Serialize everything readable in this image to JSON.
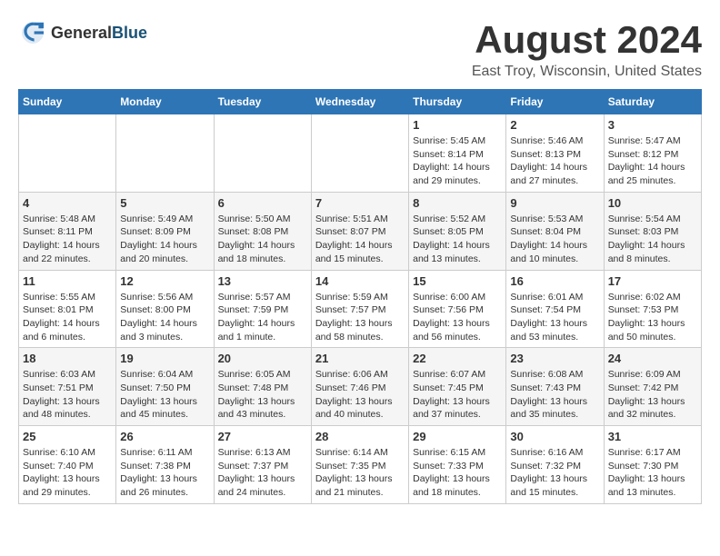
{
  "header": {
    "logo_general": "General",
    "logo_blue": "Blue",
    "title": "August 2024",
    "subtitle": "East Troy, Wisconsin, United States"
  },
  "days_of_week": [
    "Sunday",
    "Monday",
    "Tuesday",
    "Wednesday",
    "Thursday",
    "Friday",
    "Saturday"
  ],
  "weeks": [
    [
      {
        "day": "",
        "info": ""
      },
      {
        "day": "",
        "info": ""
      },
      {
        "day": "",
        "info": ""
      },
      {
        "day": "",
        "info": ""
      },
      {
        "day": "1",
        "info": "Sunrise: 5:45 AM\nSunset: 8:14 PM\nDaylight: 14 hours\nand 29 minutes."
      },
      {
        "day": "2",
        "info": "Sunrise: 5:46 AM\nSunset: 8:13 PM\nDaylight: 14 hours\nand 27 minutes."
      },
      {
        "day": "3",
        "info": "Sunrise: 5:47 AM\nSunset: 8:12 PM\nDaylight: 14 hours\nand 25 minutes."
      }
    ],
    [
      {
        "day": "4",
        "info": "Sunrise: 5:48 AM\nSunset: 8:11 PM\nDaylight: 14 hours\nand 22 minutes."
      },
      {
        "day": "5",
        "info": "Sunrise: 5:49 AM\nSunset: 8:09 PM\nDaylight: 14 hours\nand 20 minutes."
      },
      {
        "day": "6",
        "info": "Sunrise: 5:50 AM\nSunset: 8:08 PM\nDaylight: 14 hours\nand 18 minutes."
      },
      {
        "day": "7",
        "info": "Sunrise: 5:51 AM\nSunset: 8:07 PM\nDaylight: 14 hours\nand 15 minutes."
      },
      {
        "day": "8",
        "info": "Sunrise: 5:52 AM\nSunset: 8:05 PM\nDaylight: 14 hours\nand 13 minutes."
      },
      {
        "day": "9",
        "info": "Sunrise: 5:53 AM\nSunset: 8:04 PM\nDaylight: 14 hours\nand 10 minutes."
      },
      {
        "day": "10",
        "info": "Sunrise: 5:54 AM\nSunset: 8:03 PM\nDaylight: 14 hours\nand 8 minutes."
      }
    ],
    [
      {
        "day": "11",
        "info": "Sunrise: 5:55 AM\nSunset: 8:01 PM\nDaylight: 14 hours\nand 6 minutes."
      },
      {
        "day": "12",
        "info": "Sunrise: 5:56 AM\nSunset: 8:00 PM\nDaylight: 14 hours\nand 3 minutes."
      },
      {
        "day": "13",
        "info": "Sunrise: 5:57 AM\nSunset: 7:59 PM\nDaylight: 14 hours\nand 1 minute."
      },
      {
        "day": "14",
        "info": "Sunrise: 5:59 AM\nSunset: 7:57 PM\nDaylight: 13 hours\nand 58 minutes."
      },
      {
        "day": "15",
        "info": "Sunrise: 6:00 AM\nSunset: 7:56 PM\nDaylight: 13 hours\nand 56 minutes."
      },
      {
        "day": "16",
        "info": "Sunrise: 6:01 AM\nSunset: 7:54 PM\nDaylight: 13 hours\nand 53 minutes."
      },
      {
        "day": "17",
        "info": "Sunrise: 6:02 AM\nSunset: 7:53 PM\nDaylight: 13 hours\nand 50 minutes."
      }
    ],
    [
      {
        "day": "18",
        "info": "Sunrise: 6:03 AM\nSunset: 7:51 PM\nDaylight: 13 hours\nand 48 minutes."
      },
      {
        "day": "19",
        "info": "Sunrise: 6:04 AM\nSunset: 7:50 PM\nDaylight: 13 hours\nand 45 minutes."
      },
      {
        "day": "20",
        "info": "Sunrise: 6:05 AM\nSunset: 7:48 PM\nDaylight: 13 hours\nand 43 minutes."
      },
      {
        "day": "21",
        "info": "Sunrise: 6:06 AM\nSunset: 7:46 PM\nDaylight: 13 hours\nand 40 minutes."
      },
      {
        "day": "22",
        "info": "Sunrise: 6:07 AM\nSunset: 7:45 PM\nDaylight: 13 hours\nand 37 minutes."
      },
      {
        "day": "23",
        "info": "Sunrise: 6:08 AM\nSunset: 7:43 PM\nDaylight: 13 hours\nand 35 minutes."
      },
      {
        "day": "24",
        "info": "Sunrise: 6:09 AM\nSunset: 7:42 PM\nDaylight: 13 hours\nand 32 minutes."
      }
    ],
    [
      {
        "day": "25",
        "info": "Sunrise: 6:10 AM\nSunset: 7:40 PM\nDaylight: 13 hours\nand 29 minutes."
      },
      {
        "day": "26",
        "info": "Sunrise: 6:11 AM\nSunset: 7:38 PM\nDaylight: 13 hours\nand 26 minutes."
      },
      {
        "day": "27",
        "info": "Sunrise: 6:13 AM\nSunset: 7:37 PM\nDaylight: 13 hours\nand 24 minutes."
      },
      {
        "day": "28",
        "info": "Sunrise: 6:14 AM\nSunset: 7:35 PM\nDaylight: 13 hours\nand 21 minutes."
      },
      {
        "day": "29",
        "info": "Sunrise: 6:15 AM\nSunset: 7:33 PM\nDaylight: 13 hours\nand 18 minutes."
      },
      {
        "day": "30",
        "info": "Sunrise: 6:16 AM\nSunset: 7:32 PM\nDaylight: 13 hours\nand 15 minutes."
      },
      {
        "day": "31",
        "info": "Sunrise: 6:17 AM\nSunset: 7:30 PM\nDaylight: 13 hours\nand 13 minutes."
      }
    ]
  ]
}
